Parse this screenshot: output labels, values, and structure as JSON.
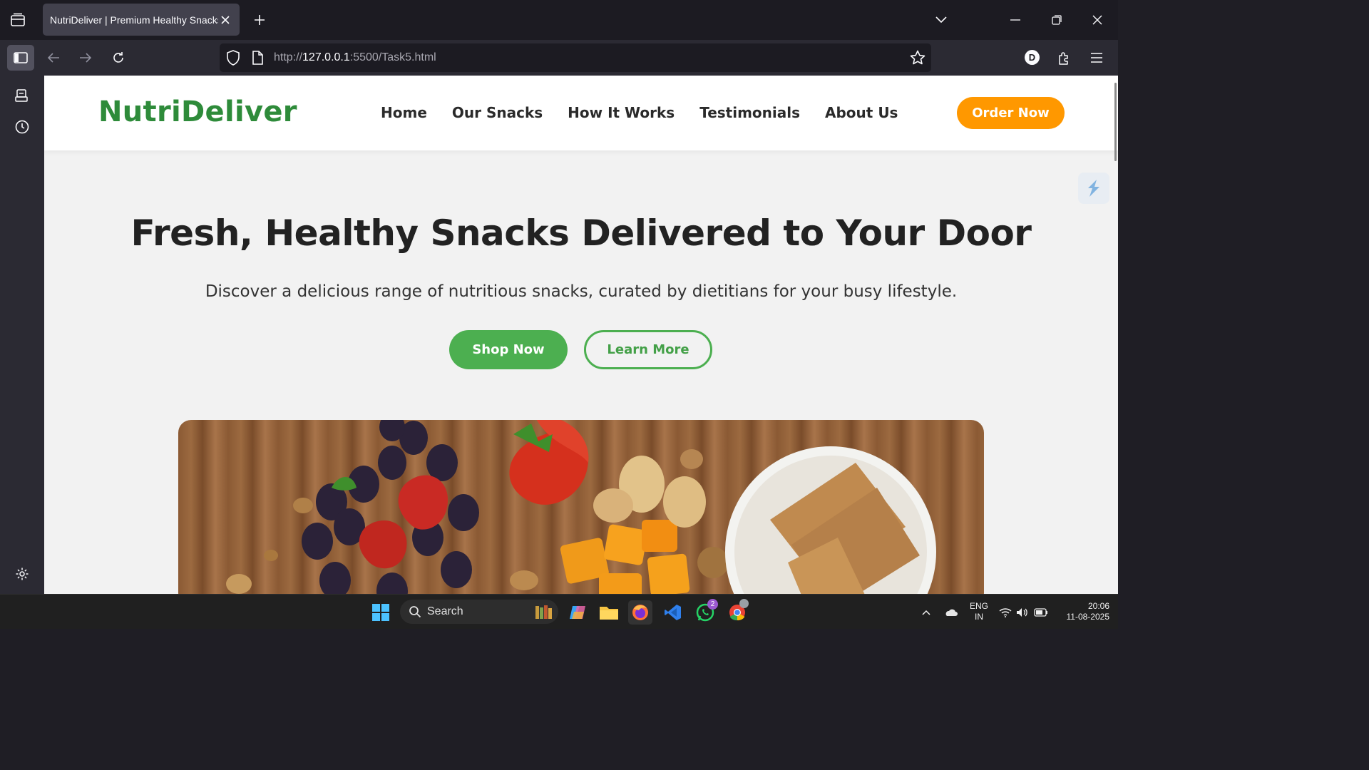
{
  "browser": {
    "tab_title": "NutriDeliver | Premium Healthy Snacks",
    "url_prefix": "http://",
    "url_host": "127.0.0.1",
    "url_rest": ":5500/Task5.html",
    "profile_initial": "D"
  },
  "site": {
    "logo": "NutriDeliver",
    "nav": [
      "Home",
      "Our Snacks",
      "How It Works",
      "Testimonials",
      "About Us"
    ],
    "order_button": "Order Now",
    "hero_title": "Fresh, Healthy Snacks Delivered to Your Door",
    "hero_subtitle": "Discover a delicious range of nutritious snacks, curated by dietitians for your busy lifestyle.",
    "primary_button": "Shop Now",
    "secondary_button": "Learn More",
    "colors": {
      "brand_green": "#2e8b3a",
      "button_green": "#4caf50",
      "accent_orange": "#ff9800"
    }
  },
  "taskbar": {
    "search_placeholder": "Search",
    "whatsapp_badge": "2",
    "language": "ENG",
    "region": "IN",
    "time": "20:06",
    "date": "11-08-2025"
  }
}
